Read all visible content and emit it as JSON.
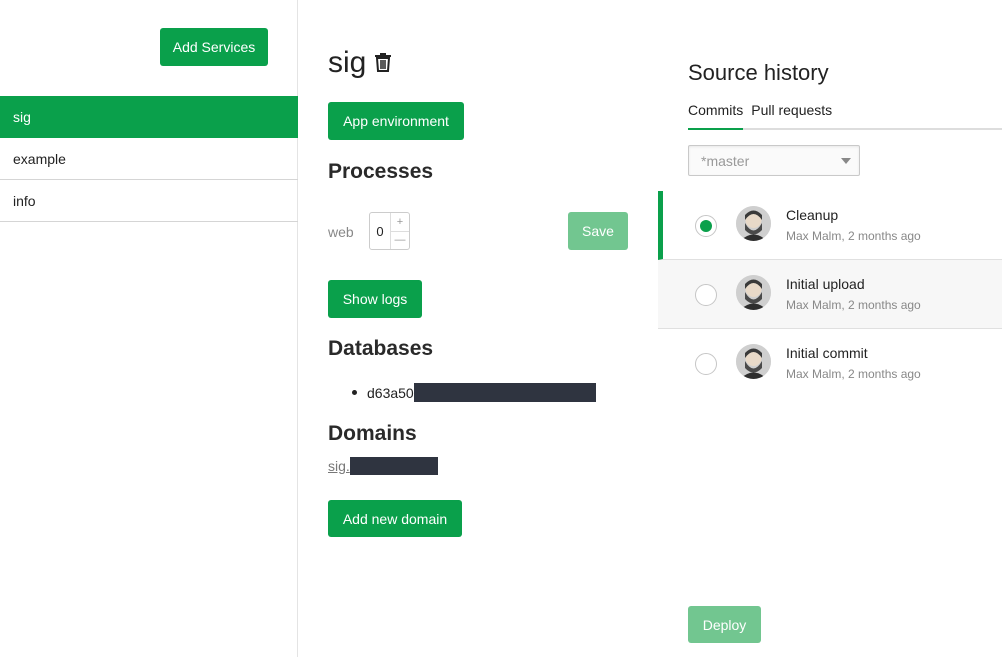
{
  "sidebar": {
    "add_services_label": "Add Services",
    "items": [
      {
        "label": "sig",
        "active": true
      },
      {
        "label": "example",
        "active": false
      },
      {
        "label": "info",
        "active": false
      }
    ]
  },
  "app": {
    "name": "sig",
    "env_button": "App environment",
    "processes_heading": "Processes",
    "process_name": "web",
    "process_count": "0",
    "stepper_plus": "+",
    "stepper_minus": "—",
    "save_label": "Save",
    "show_logs_label": "Show logs",
    "databases_heading": "Databases",
    "database_prefix": "d63a50",
    "domains_heading": "Domains",
    "domain_prefix": "sig.",
    "add_domain_label": "Add new domain"
  },
  "source_history": {
    "title": "Source history",
    "tabs": [
      "Commits",
      "Pull requests"
    ],
    "branch": "*master",
    "commits": [
      {
        "message": "Cleanup",
        "meta": "Max Malm, 2 months ago",
        "selected": true
      },
      {
        "message": "Initial upload",
        "meta": "Max Malm, 2 months ago",
        "selected": false
      },
      {
        "message": "Initial commit",
        "meta": "Max Malm, 2 months ago",
        "selected": false
      }
    ],
    "deploy_label": "Deploy"
  },
  "colors": {
    "accent": "#0aa04b",
    "accent_disabled": "#72c690",
    "redaction": "#2f3440"
  },
  "icons": {
    "delete": "trash-icon",
    "dropdown": "chevron-down-icon"
  }
}
